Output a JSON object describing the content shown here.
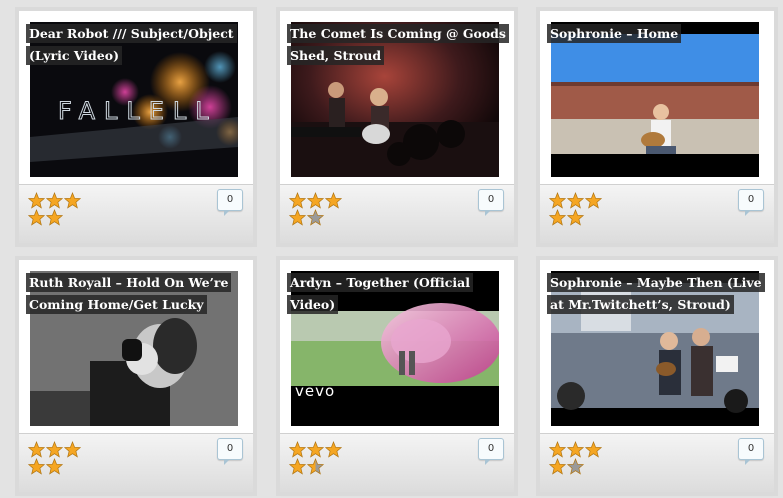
{
  "colors": {
    "background": "#e3e3e3",
    "star_gold": "#f5a623",
    "star_gray": "#9a9a9a",
    "title_bg": "#262626"
  },
  "videos": [
    {
      "title": "Dear Robot /// Subject/Object (Lyric Video)",
      "thumb_text": "FALLELL",
      "rating": 5,
      "comments": "0"
    },
    {
      "title": "The Comet Is Coming @ Goods Shed, Stroud",
      "rating": 4,
      "comments": "0"
    },
    {
      "title": "Sophronie – Home",
      "rating": 5,
      "comments": "0"
    },
    {
      "title": "Ruth Royall – Hold On We’re Coming Home/Get Lucky",
      "rating": 5,
      "comments": "0"
    },
    {
      "title": "Ardyn – Together (Official Video)",
      "thumb_text": "vevo",
      "rating": 4.5,
      "comments": "0"
    },
    {
      "title": "Sophronie – Maybe Then (Live at Mr.Twitchett’s, Stroud)",
      "rating": 4,
      "comments": "0"
    }
  ]
}
